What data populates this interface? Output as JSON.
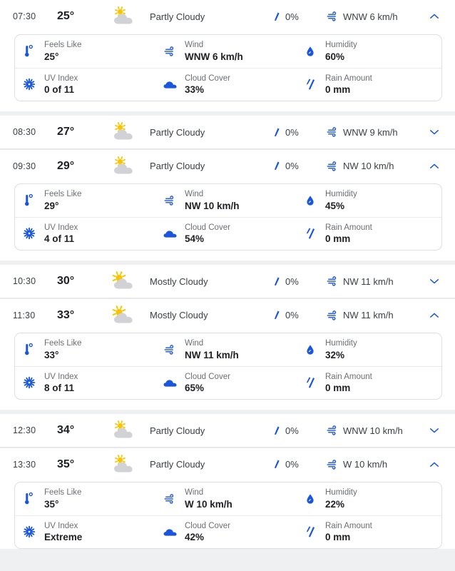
{
  "detail_labels": {
    "feels_like": "Feels Like",
    "wind": "Wind",
    "humidity": "Humidity",
    "uv_index": "UV Index",
    "cloud_cover": "Cloud Cover",
    "rain_amount": "Rain Amount"
  },
  "icons": {
    "partly_cloudy": "partly-cloudy-icon",
    "mostly_cloudy": "mostly-cloudy-icon",
    "precipitation": "raindrop-icon",
    "wind": "wind-icon",
    "expand": "chevron-down-icon",
    "collapse": "chevron-up-icon",
    "feels_like": "thermometer-icon",
    "humidity": "humidity-drop-icon",
    "uv_index": "uv-sun-icon",
    "cloud_cover": "cloud-icon",
    "rain_amount": "rain-drops-icon"
  },
  "colors": {
    "accent": "#1a56db",
    "accent_alt": "#2b5fd9",
    "cloud": "#d0d2d5",
    "sun": "#f7c600",
    "text": "#202124",
    "muted": "#6b6f73",
    "divider": "#e8eaec",
    "page_bg": "#eef0f2"
  },
  "hours": [
    {
      "time": "07:30",
      "temp": "25°",
      "condition": "Partly Cloudy",
      "condition_icon": "partly_cloudy",
      "precip": "0%",
      "wind": "WNW 6 km/h",
      "expanded": true,
      "details": {
        "feels_like": "25°",
        "wind": "WNW 6 km/h",
        "humidity": "60%",
        "uv_index": "0 of 11",
        "cloud_cover": "33%",
        "rain_amount": "0 mm"
      }
    },
    {
      "time": "08:30",
      "temp": "27°",
      "condition": "Partly Cloudy",
      "condition_icon": "partly_cloudy",
      "precip": "0%",
      "wind": "WNW 9 km/h",
      "expanded": false,
      "details": null
    },
    {
      "time": "09:30",
      "temp": "29°",
      "condition": "Partly Cloudy",
      "condition_icon": "partly_cloudy",
      "precip": "0%",
      "wind": "NW 10 km/h",
      "expanded": true,
      "details": {
        "feels_like": "29°",
        "wind": "NW 10 km/h",
        "humidity": "45%",
        "uv_index": "4 of 11",
        "cloud_cover": "54%",
        "rain_amount": "0 mm"
      }
    },
    {
      "time": "10:30",
      "temp": "30°",
      "condition": "Mostly Cloudy",
      "condition_icon": "mostly_cloudy",
      "precip": "0%",
      "wind": "NW 11 km/h",
      "expanded": false,
      "details": null
    },
    {
      "time": "11:30",
      "temp": "33°",
      "condition": "Mostly Cloudy",
      "condition_icon": "mostly_cloudy",
      "precip": "0%",
      "wind": "NW 11 km/h",
      "expanded": true,
      "details": {
        "feels_like": "33°",
        "wind": "NW 11 km/h",
        "humidity": "32%",
        "uv_index": "8 of 11",
        "cloud_cover": "65%",
        "rain_amount": "0 mm"
      }
    },
    {
      "time": "12:30",
      "temp": "34°",
      "condition": "Partly Cloudy",
      "condition_icon": "partly_cloudy",
      "precip": "0%",
      "wind": "WNW 10 km/h",
      "expanded": false,
      "details": null
    },
    {
      "time": "13:30",
      "temp": "35°",
      "condition": "Partly Cloudy",
      "condition_icon": "partly_cloudy",
      "precip": "0%",
      "wind": "W 10 km/h",
      "expanded": true,
      "details": {
        "feels_like": "35°",
        "wind": "W 10 km/h",
        "humidity": "22%",
        "uv_index": "Extreme",
        "cloud_cover": "42%",
        "rain_amount": "0 mm"
      }
    }
  ]
}
